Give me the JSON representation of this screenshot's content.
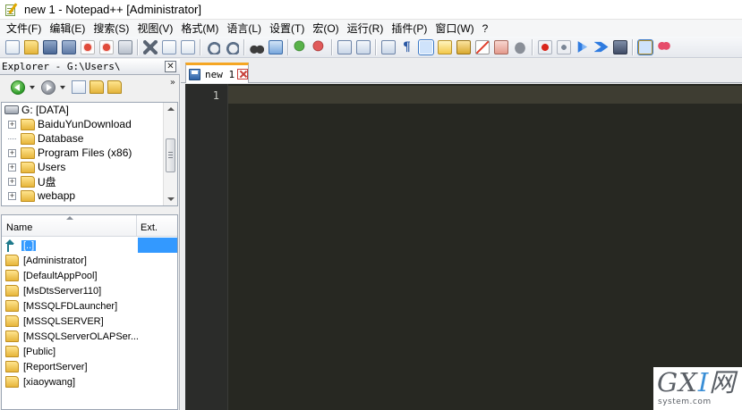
{
  "window": {
    "title": "new 1 - Notepad++ [Administrator]"
  },
  "menu": [
    "文件(F)",
    "编辑(E)",
    "搜索(S)",
    "视图(V)",
    "格式(M)",
    "语言(L)",
    "设置(T)",
    "宏(O)",
    "运行(R)",
    "插件(P)",
    "窗口(W)",
    "?"
  ],
  "toolbar": {
    "icons": [
      "new-file",
      "open-file",
      "save",
      "save-all",
      "close",
      "close-all",
      "print",
      "cut",
      "copy",
      "paste",
      "undo",
      "redo",
      "find",
      "replace",
      "zoom-in",
      "zoom-out",
      "sync-vertical",
      "sync-horizontal",
      "word-wrap",
      "show-all-characters",
      "indent-guide",
      "user-defined-language",
      "document-map",
      "function-list",
      "folder-as-workspace",
      "monitoring",
      "record-macro",
      "stop-recording",
      "play-macro",
      "run-macro-multiple",
      "save-macro",
      "explorer-plugin",
      "favorites"
    ]
  },
  "explorer": {
    "title": "Explorer - G:\\Users\\",
    "close_label": "✕",
    "more_label": "»",
    "tree": {
      "drive": "G: [DATA]",
      "items": [
        {
          "label": "BaiduYunDownload",
          "expandable": true
        },
        {
          "label": "Database",
          "expandable": false
        },
        {
          "label": "Program Files (x86)",
          "expandable": true
        },
        {
          "label": "Users",
          "expandable": true
        },
        {
          "label": "U盘",
          "expandable": true
        },
        {
          "label": "webapp",
          "expandable": true
        }
      ]
    },
    "files": {
      "columns": {
        "name": "Name",
        "ext": "Ext."
      },
      "rows": [
        {
          "name": "[..]",
          "selected": true
        },
        {
          "name": "[Administrator]"
        },
        {
          "name": "[DefaultAppPool]"
        },
        {
          "name": "[MsDtsServer110]"
        },
        {
          "name": "[MSSQLFDLauncher]"
        },
        {
          "name": "[MSSQLSERVER]"
        },
        {
          "name": "[MSSQLServerOLAPSer..."
        },
        {
          "name": "[Public]"
        },
        {
          "name": "[ReportServer]"
        },
        {
          "name": "[xiaoywang]"
        }
      ]
    }
  },
  "editor": {
    "tab": {
      "label": "new 1"
    },
    "line_numbers": [
      "1"
    ],
    "colors": {
      "background": "#272822",
      "gutter": "#2b2c2a",
      "current_line": "#3e3d32"
    }
  },
  "watermark": {
    "logo_main": "GX",
    "logo_accent": "I",
    "logo_end": "网",
    "sub": "system.com"
  }
}
